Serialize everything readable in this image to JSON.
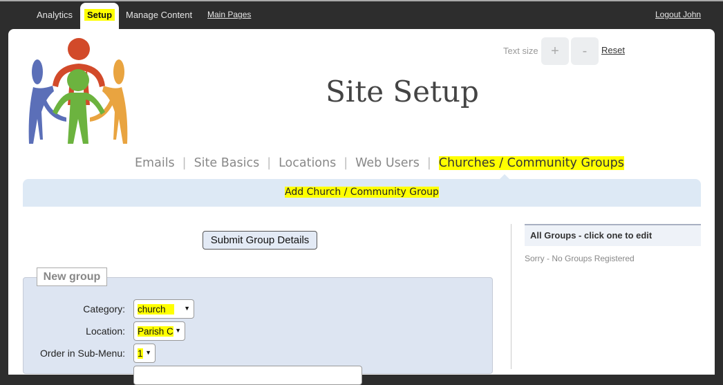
{
  "topnav": {
    "analytics": "Analytics",
    "setup": "Setup",
    "manage": "Manage Content",
    "main_pages": "Main Pages",
    "logout": "Logout John"
  },
  "text_size": {
    "label": "Text size",
    "plus": "+",
    "minus": "-",
    "reset": "Reset"
  },
  "title": "Site Setup",
  "subnav": [
    "Emails",
    "Site Basics",
    "Locations",
    "Web Users",
    "Churches / Community Groups"
  ],
  "banner": "Add Church / Community Group",
  "submit": "Submit Group Details",
  "form": {
    "legend": "New group",
    "fields": [
      {
        "label": "Category:",
        "value": "church"
      },
      {
        "label": "Location:",
        "value": "Parish C"
      },
      {
        "label": "Order in Sub-Menu:",
        "value": "1"
      }
    ]
  },
  "groups": {
    "header": "All Groups - click one to edit",
    "empty": "Sorry - No Groups Registered"
  },
  "colors": {
    "highlight": "#ffff00",
    "dark": "#2d2d2d",
    "banner": "#dde9f5"
  }
}
